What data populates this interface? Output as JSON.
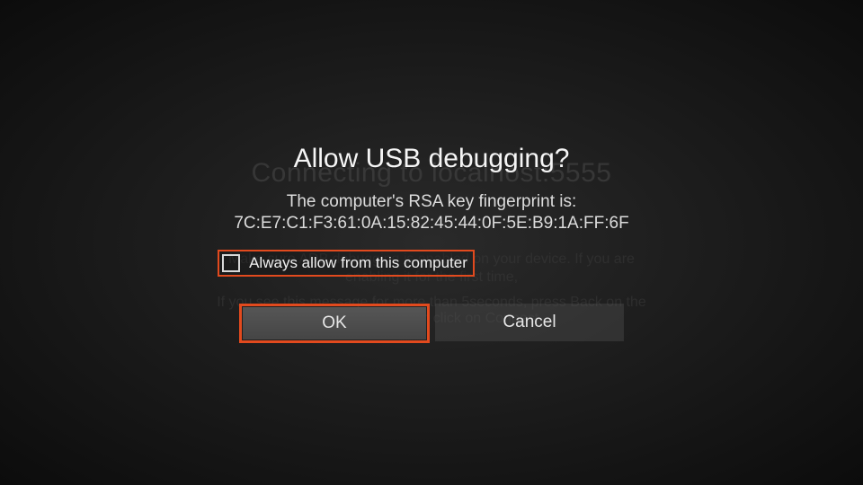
{
  "background": {
    "line1": "Connecting to localhost:5555",
    "line2": "Make sure ADB debugging is enabled on your device. If you are",
    "line3": "enabling it for the first time,",
    "line4": "If you see this message for more than 5seconds, press Back on the",
    "line5": "remote and then click on Connect"
  },
  "dialog": {
    "title": "Allow USB debugging?",
    "fingerprint_label": "The computer's RSA key fingerprint is:",
    "fingerprint_value": "7C:E7:C1:F3:61:0A:15:82:45:44:0F:5E:B9:1A:FF:6F",
    "always_allow_label": "Always allow from this computer",
    "ok_label": "OK",
    "cancel_label": "Cancel"
  },
  "colors": {
    "highlight": "#e24a1e"
  }
}
